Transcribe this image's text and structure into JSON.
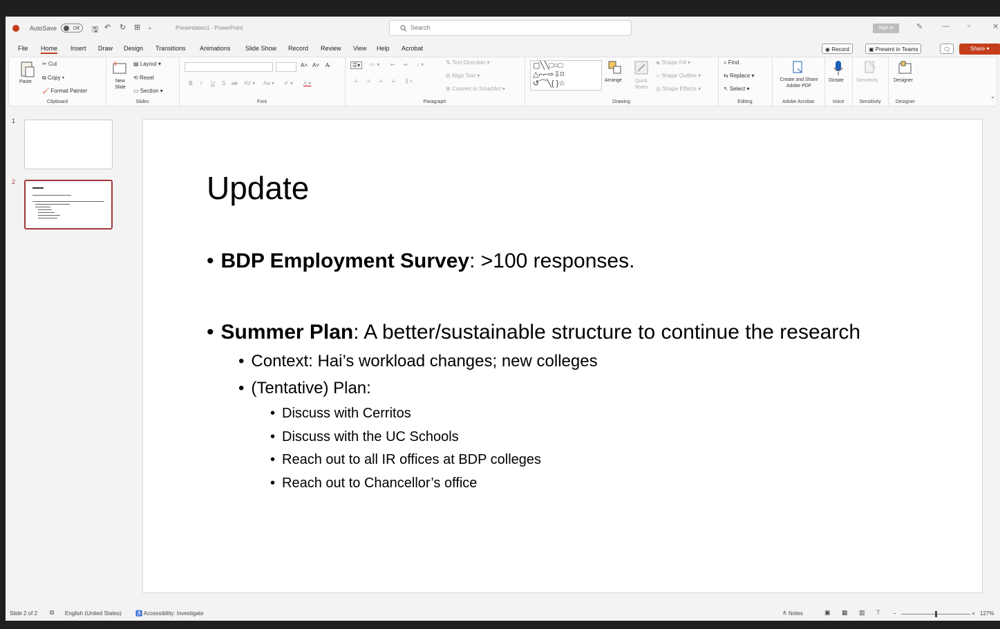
{
  "titlebar": {
    "autosave_label": "AutoSave",
    "autosave_state": "Off",
    "doc_title": "Presentation1 - PowerPoint",
    "search_placeholder": "Search",
    "signin_label": "Sign in"
  },
  "menu": {
    "items": [
      "File",
      "Home",
      "Insert",
      "Draw",
      "Design",
      "Transitions",
      "Animations",
      "Slide Show",
      "Record",
      "Review",
      "View",
      "Help",
      "Acrobat"
    ],
    "active": "Home",
    "record_btn": "Record",
    "present_btn": "Present in Teams",
    "share_btn": "Share"
  },
  "ribbon": {
    "clipboard": {
      "paste": "Paste",
      "cut": "Cut",
      "copy": "Copy",
      "format_painter": "Format Painter",
      "label": "Clipboard"
    },
    "slides": {
      "new_slide": "New Slide",
      "layout": "Layout",
      "reset": "Reset",
      "section": "Section",
      "label": "Slides"
    },
    "font": {
      "label": "Font"
    },
    "paragraph": {
      "text_direction": "Text Direction",
      "align_text": "Align Text",
      "convert_smartart": "Convert to SmartArt",
      "label": "Paragraph"
    },
    "drawing": {
      "arrange": "Arrange",
      "quick_styles": "Quick Styles",
      "shape_fill": "Shape Fill",
      "shape_outline": "Shape Outline",
      "shape_effects": "Shape Effects",
      "label": "Drawing"
    },
    "editing": {
      "find": "Find",
      "replace": "Replace",
      "select": "Select",
      "label": "Editing"
    },
    "acrobat": {
      "create_share": "Create and Share Adobe PDF",
      "label": "Adobe Acrobat"
    },
    "voice": {
      "dictate": "Dictate",
      "label": "Voice"
    },
    "sensitivity": {
      "sensitivity_btn": "Sensitivity",
      "label": "Sensitivity"
    },
    "designer": {
      "designer_btn": "Designer",
      "label": "Designer"
    }
  },
  "thumbnails": [
    {
      "number": "1"
    },
    {
      "number": "2",
      "selected": true
    }
  ],
  "slide": {
    "title": "Update",
    "bullet1_bold": "BDP Employment Survey",
    "bullet1_rest": ": >100 responses.",
    "bullet2_bold": "Summer Plan",
    "bullet2_rest": ": A better/sustainable structure to continue the research",
    "sub1": "Context: Hai’s workload changes; new colleges",
    "sub2": "(Tentative) Plan:",
    "subsub": [
      "Discuss with Cerritos",
      "Discuss with the UC Schools",
      "Reach out to all IR offices at BDP colleges",
      "Reach out to Chancellor’s office"
    ]
  },
  "status": {
    "slide_count": "Slide 2 of 2",
    "language": "English (United States)",
    "accessibility": "Accessibility: Investigate",
    "notes": "Notes",
    "zoom": "127%"
  }
}
